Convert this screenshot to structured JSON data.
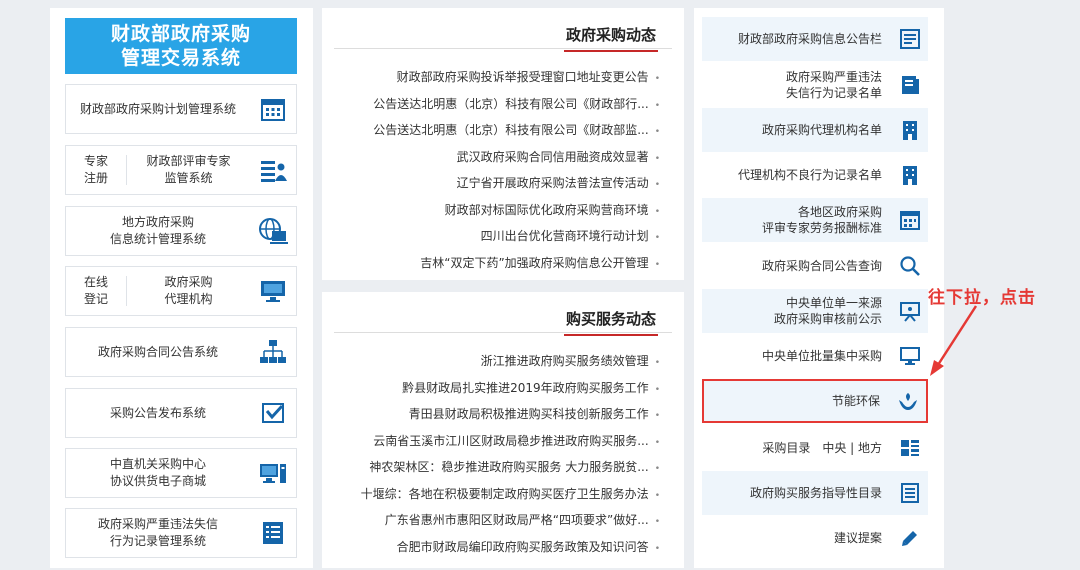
{
  "left": {
    "banner": "财政部政府采购\n管理交易系统",
    "cards": [
      {
        "label": "财政部政府采购计划管理系统",
        "icon": "calendar-icon"
      },
      {
        "label_a": "专家\n注册",
        "label_b": "财政部评审专家\n监管系统",
        "icon": "expert-icon"
      },
      {
        "label": "地方政府采购\n信息统计管理系统",
        "icon": "globe-computer-icon"
      },
      {
        "label_a": "在线\n登记",
        "label_b": "政府采购\n代理机构",
        "icon": "monitor-icon"
      },
      {
        "label": "政府采购合同公告系统",
        "icon": "network-icon"
      },
      {
        "label": "采购公告发布系统",
        "icon": "checkmark-icon"
      },
      {
        "label": "中直机关采购中心\n协议供货电子商城",
        "icon": "computer-icon"
      },
      {
        "label": "政府采购严重违法失信\n行为记录管理系统",
        "icon": "document-list-icon"
      }
    ]
  },
  "news": {
    "title": "政府采购动态",
    "items": [
      "财政部政府采购投诉举报受理窗口地址变更公告",
      "公告送达北明惠（北京）科技有限公司《财政部行...",
      "公告送达北明惠（北京）科技有限公司《财政部监...",
      "武汉政府采购合同信用融资成效显著",
      "辽宁省开展政府采购法普法宣传活动",
      "财政部对标国际优化政府采购营商环境",
      "四川出台优化营商环境行动计划",
      "吉林“双定下药”加强政府采购信息公开管理"
    ]
  },
  "service": {
    "title": "购买服务动态",
    "items": [
      "浙江推进政府购买服务绩效管理",
      "黔县财政局扎实推进2019年政府购买服务工作",
      "青田县财政局积极推进购买科技创新服务工作",
      "云南省玉溪市江川区财政局稳步推进政府购买服务...",
      "神农架林区：稳步推进政府购买服务 大力服务脱贫...",
      "十堰综：各地在积极要制定政府购买医疗卫生服务办法",
      "广东省惠州市惠阳区财政局严格“四项要求”做好...",
      "合肥市财政局编印政府购买服务政策及知识问答"
    ]
  },
  "right": {
    "items": [
      {
        "label": "财政部政府采购信息公告栏",
        "icon": "notice-board-icon"
      },
      {
        "label": "政府采购严重违法\n失信行为记录名单",
        "icon": "book-icon"
      },
      {
        "label": "政府采购代理机构名单",
        "icon": "building-icon"
      },
      {
        "label": "代理机构不良行为记录名单",
        "icon": "building-icon"
      },
      {
        "label": "各地区政府采购\n评审专家劳务报酬标准",
        "icon": "calendar-icon"
      },
      {
        "label": "政府采购合同公告查询",
        "icon": "search-icon"
      },
      {
        "label": "中央单位单一来源\n政府采购审核前公示",
        "icon": "presentation-icon"
      },
      {
        "label": "中央单位批量集中采购",
        "icon": "monitor-icon"
      },
      {
        "label": "节能环保",
        "icon": "eco-hands-icon"
      },
      {
        "label": "采购目录　中央 | 地方",
        "icon": "grid-icon"
      },
      {
        "label": "政府购买服务指导性目录",
        "icon": "list-icon"
      },
      {
        "label": "建议提案",
        "icon": "pencil-icon"
      }
    ]
  },
  "annotation": "往下拉，点击",
  "colors": {
    "accent": "#29a4e6",
    "highlight": "#e53935",
    "icon": "#1565a9"
  }
}
